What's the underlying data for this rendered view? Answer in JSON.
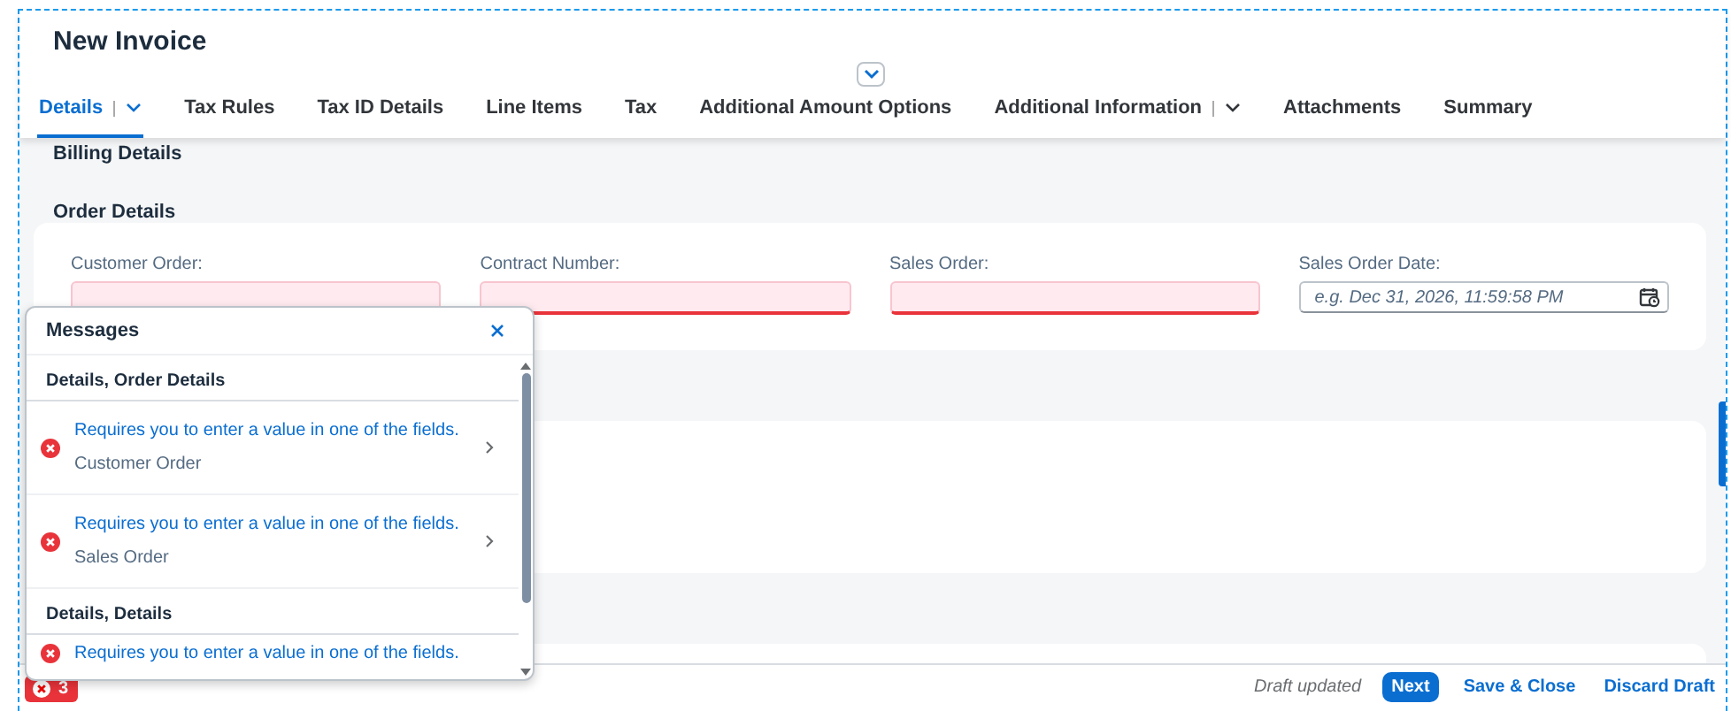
{
  "header": {
    "title": "New Invoice"
  },
  "tabs": [
    {
      "label": "Details",
      "selected": true,
      "menu": true
    },
    {
      "label": "Tax Rules",
      "selected": false,
      "menu": false
    },
    {
      "label": "Tax ID Details",
      "selected": false,
      "menu": false
    },
    {
      "label": "Line Items",
      "selected": false,
      "menu": false
    },
    {
      "label": "Tax",
      "selected": false,
      "menu": false
    },
    {
      "label": "Additional Amount Options",
      "selected": false,
      "menu": false
    },
    {
      "label": "Additional Information",
      "selected": false,
      "menu": true
    },
    {
      "label": "Attachments",
      "selected": false,
      "menu": false
    },
    {
      "label": "Summary",
      "selected": false,
      "menu": false
    }
  ],
  "sections": [
    {
      "title": "Billing Details"
    },
    {
      "title": "Order Details",
      "fields": [
        {
          "label": "Customer Order:",
          "kind": "text",
          "error": true
        },
        {
          "label": "Contract Number:",
          "kind": "text",
          "error": true
        },
        {
          "label": "Sales Order:",
          "kind": "text",
          "error": true
        },
        {
          "label": "Sales Order Date:",
          "kind": "date",
          "error": false,
          "placeholder": "e.g. Dec 31, 2026, 11:59:58 PM"
        }
      ]
    }
  ],
  "messages": {
    "title": "Messages",
    "groups": [
      {
        "title": "Details, Order Details",
        "items": [
          {
            "text": "Requires you to enter a value in one of the fields.",
            "subtitle": "Customer Order"
          },
          {
            "text": "Requires you to enter a value in one of the fields.",
            "subtitle": "Sales Order"
          }
        ]
      },
      {
        "title": "Details, Details",
        "items": [
          {
            "text": "Requires you to enter a value in one of the fields."
          }
        ]
      }
    ]
  },
  "footer": {
    "error_count": "3",
    "status": "Draft updated",
    "buttons": [
      {
        "label": "Next",
        "kind": "primary"
      },
      {
        "label": "Save & Close",
        "kind": "link"
      },
      {
        "label": "Discard Draft",
        "kind": "link"
      }
    ]
  }
}
